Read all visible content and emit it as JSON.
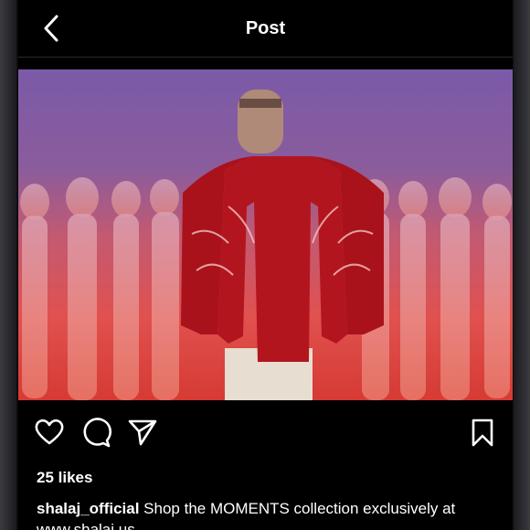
{
  "header": {
    "title": "Post",
    "back_icon": "chevron-left-icon"
  },
  "post": {
    "likes": "25 likes",
    "username": "shalaj_official",
    "caption": "Shop the MOMENTS collection exclusively at",
    "caption_link": "www.shalaj.us"
  },
  "actions": {
    "like_icon": "heart-icon",
    "comment_icon": "comment-icon",
    "share_icon": "send-icon",
    "save_icon": "bookmark-icon"
  },
  "colors": {
    "background": "#000000",
    "text": "#ffffff",
    "sky_top": "#7a5aa6",
    "fabric_red": "#b0141c"
  }
}
